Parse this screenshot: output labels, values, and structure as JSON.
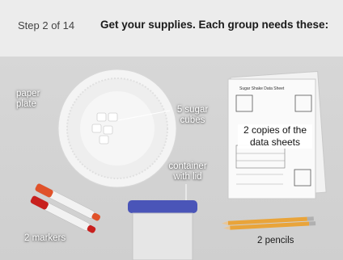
{
  "header": {
    "step": "Step 2 of 14",
    "title": "Get your supplies. Each group needs these:"
  },
  "labels": {
    "paper_plate": "paper\nplate",
    "sugar_cubes": "5 sugar\ncubes",
    "container": "container\nwith lid",
    "data_sheets": "2 copies of the\ndata sheets",
    "markers": "2 markers",
    "pencils": "2 pencils"
  },
  "sheet": {
    "title": "Sugar Shake Data Sheet"
  },
  "colors": {
    "marker_orange": "#e0522a",
    "marker_red": "#c8201e",
    "lid_blue": "#4a55b8",
    "pencil_yellow": "#e9a43a"
  }
}
